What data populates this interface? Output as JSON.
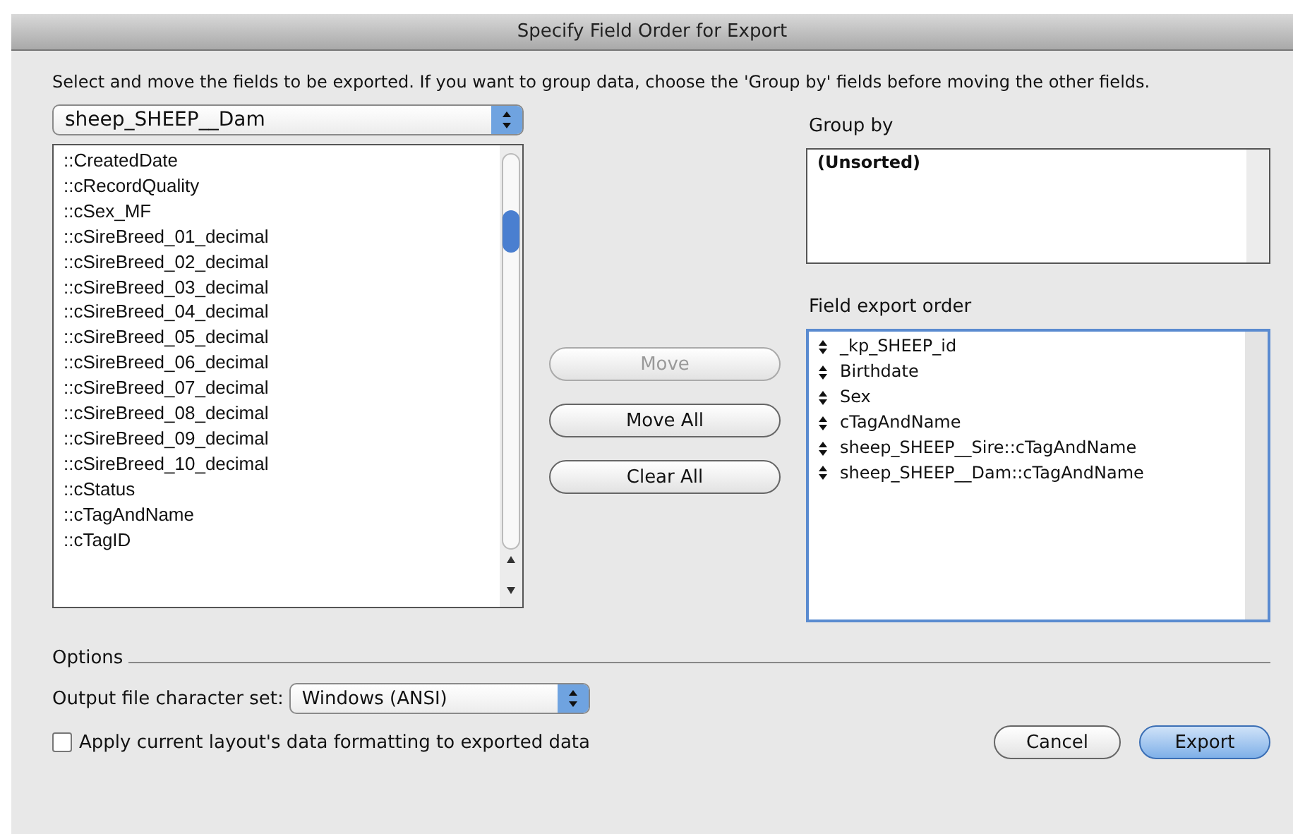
{
  "window": {
    "title": "Specify Field Order for Export"
  },
  "instructions": "Select and move the fields to be exported.  If you want to group data, choose the 'Group by' fields before moving the other fields.",
  "table_popup": {
    "value": "sheep_SHEEP__Dam"
  },
  "source_fields": [
    "::CreatedDate",
    "::cRecordQuality",
    "::cSex_MF",
    "::cSireBreed_01_decimal",
    "::cSireBreed_02_decimal",
    "::cSireBreed_03_decimal",
    "::cSireBreed_04_decimal",
    "::cSireBreed_05_decimal",
    "::cSireBreed_06_decimal",
    "::cSireBreed_07_decimal",
    "::cSireBreed_08_decimal",
    "::cSireBreed_09_decimal",
    "::cSireBreed_10_decimal",
    "::cStatus",
    "::cTagAndName",
    "::cTagID"
  ],
  "buttons": [
    {
      "label": "Move",
      "disabled": true
    },
    {
      "label": "Move All",
      "disabled": false
    },
    {
      "label": "Clear All",
      "disabled": false
    }
  ],
  "group_by": {
    "label": "Group by",
    "items": [
      "(Unsorted)"
    ]
  },
  "export_order": {
    "label": "Field export order",
    "items": [
      "_kp_SHEEP_id",
      "Birthdate",
      "Sex",
      "cTagAndName",
      "sheep_SHEEP__Sire::cTagAndName",
      "sheep_SHEEP__Dam::cTagAndName"
    ]
  },
  "options": {
    "label": "Options",
    "charset_label": "Output file character set:",
    "charset_value": "Windows (ANSI)",
    "apply_formatting": {
      "label": "Apply current layout's data formatting to exported data",
      "checked": false
    }
  },
  "footer_buttons": [
    {
      "label": "Cancel",
      "default": false
    },
    {
      "label": "Export",
      "default": true
    }
  ]
}
